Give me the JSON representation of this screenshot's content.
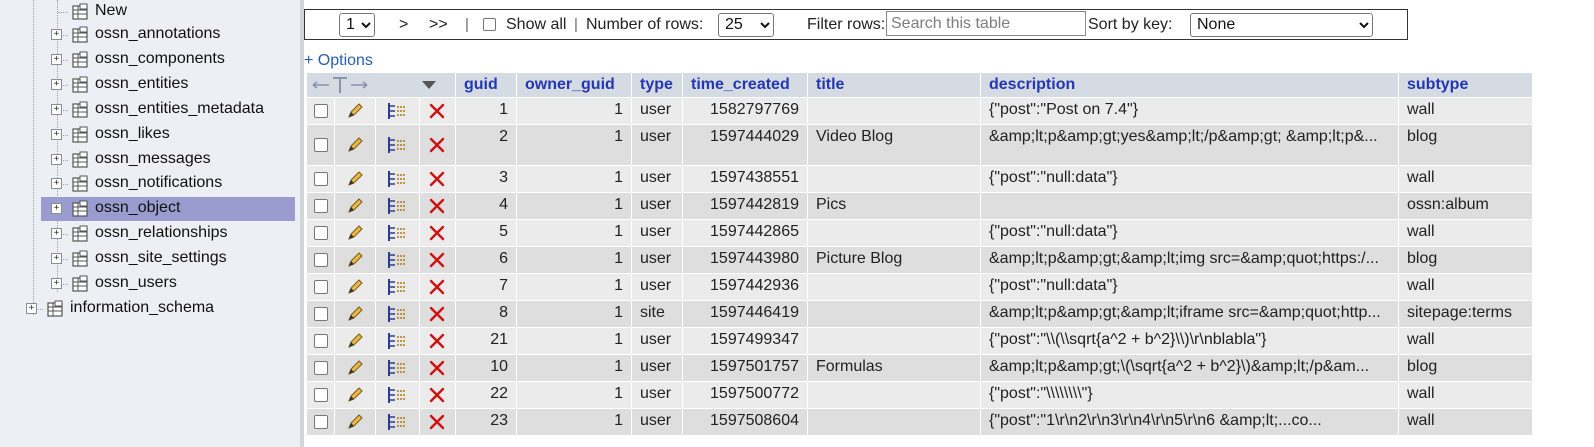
{
  "nav": {
    "items": [
      {
        "label": "New",
        "expander": ""
      },
      {
        "label": "ossn_annotations",
        "expander": "+"
      },
      {
        "label": "ossn_components",
        "expander": "+"
      },
      {
        "label": "ossn_entities",
        "expander": "+"
      },
      {
        "label": "ossn_entities_metadata",
        "expander": "+"
      },
      {
        "label": "ossn_likes",
        "expander": "+"
      },
      {
        "label": "ossn_messages",
        "expander": "+"
      },
      {
        "label": "ossn_notifications",
        "expander": "+"
      },
      {
        "label": "ossn_object",
        "expander": "+",
        "selected": true
      },
      {
        "label": "ossn_relationships",
        "expander": "+"
      },
      {
        "label": "ossn_site_settings",
        "expander": "+"
      },
      {
        "label": "ossn_users",
        "expander": "+"
      },
      {
        "label": "information_schema",
        "expander": "+"
      }
    ]
  },
  "toolbar": {
    "page_select": "1",
    "next": ">",
    "last": ">>",
    "sep": "|",
    "show_all": "Show all",
    "rows_label": "Number of rows:",
    "rows_value": "25",
    "filter_label": "Filter rows:",
    "filter_placeholder": "Search this table",
    "sort_label": "Sort by key:",
    "sort_value": "None"
  },
  "options_link": "+ Options",
  "table": {
    "columns": [
      "guid",
      "owner_guid",
      "type",
      "time_created",
      "title",
      "description",
      "subtype"
    ],
    "rows": [
      {
        "guid": "1",
        "owner_guid": "1",
        "type": "user",
        "time_created": "1582797769",
        "title": "",
        "description": "{\"post\":\"Post on 7.4\"}",
        "subtype": "wall"
      },
      {
        "guid": "2",
        "owner_guid": "1",
        "type": "user",
        "time_created": "1597444029",
        "title": "Video Blog",
        "description": "&amp;lt;p&amp;gt;yes&amp;lt;/p&amp;gt; &amp;lt;p&...",
        "subtype": "blog"
      },
      {
        "guid": "3",
        "owner_guid": "1",
        "type": "user",
        "time_created": "1597438551",
        "title": "",
        "description": "{\"post\":\"null:data\"}",
        "subtype": "wall"
      },
      {
        "guid": "4",
        "owner_guid": "1",
        "type": "user",
        "time_created": "1597442819",
        "title": "Pics",
        "description": "",
        "subtype": "ossn:album"
      },
      {
        "guid": "5",
        "owner_guid": "1",
        "type": "user",
        "time_created": "1597442865",
        "title": "",
        "description": "{\"post\":\"null:data\"}",
        "subtype": "wall"
      },
      {
        "guid": "6",
        "owner_guid": "1",
        "type": "user",
        "time_created": "1597443980",
        "title": "Picture Blog",
        "description": "&amp;lt;p&amp;gt;&amp;lt;img src=&amp;quot;https:/...",
        "subtype": "blog"
      },
      {
        "guid": "7",
        "owner_guid": "1",
        "type": "user",
        "time_created": "1597442936",
        "title": "",
        "description": "{\"post\":\"null:data\"}",
        "subtype": "wall"
      },
      {
        "guid": "8",
        "owner_guid": "1",
        "type": "site",
        "time_created": "1597446419",
        "title": "",
        "description": "&amp;lt;p&amp;gt;&amp;lt;iframe src=&amp;quot;http...",
        "subtype": "sitepage:terms"
      },
      {
        "guid": "21",
        "owner_guid": "1",
        "type": "user",
        "time_created": "1597499347",
        "title": "",
        "description": "{\"post\":\"\\\\(\\\\sqrt{a^2 + b^2}\\\\)\\r\\nblabla\"}",
        "subtype": "wall"
      },
      {
        "guid": "10",
        "owner_guid": "1",
        "type": "user",
        "time_created": "1597501757",
        "title": "Formulas",
        "description": "&amp;lt;p&amp;gt;\\(\\sqrt{a^2 + b^2}\\)&amp;lt;/p&am...",
        "subtype": "blog"
      },
      {
        "guid": "22",
        "owner_guid": "1",
        "type": "user",
        "time_created": "1597500772",
        "title": "",
        "description": "{\"post\":\"\\\\\\\\\\\\\\\\\"}",
        "subtype": "wall"
      },
      {
        "guid": "23",
        "owner_guid": "1",
        "type": "user",
        "time_created": "1597508604",
        "title": "",
        "description": "{\"post\":\"1\\r\\n2\\r\\n3\\r\\n4\\r\\n5\\r\\n6 &amp;lt;...co...",
        "subtype": "wall"
      }
    ]
  },
  "icons": {
    "checkbox": "checkbox-icon",
    "edit": "pencil-edit-icon",
    "copy": "copy-row-icon",
    "delete": "delete-x-icon",
    "sort_menu": "dropdown-triangle-icon",
    "column_arrows": "column-resize-arrows-icon"
  },
  "colors": {
    "nav_bg": "#eceff3",
    "nav_selected": "#9a9ccf",
    "header_bg": "#d5dbe3",
    "header_text": "#2437b3",
    "row_odd": "#ebebeb",
    "row_even": "#dedede",
    "delete_red": "#d01010",
    "link_blue": "#2a5db0"
  }
}
